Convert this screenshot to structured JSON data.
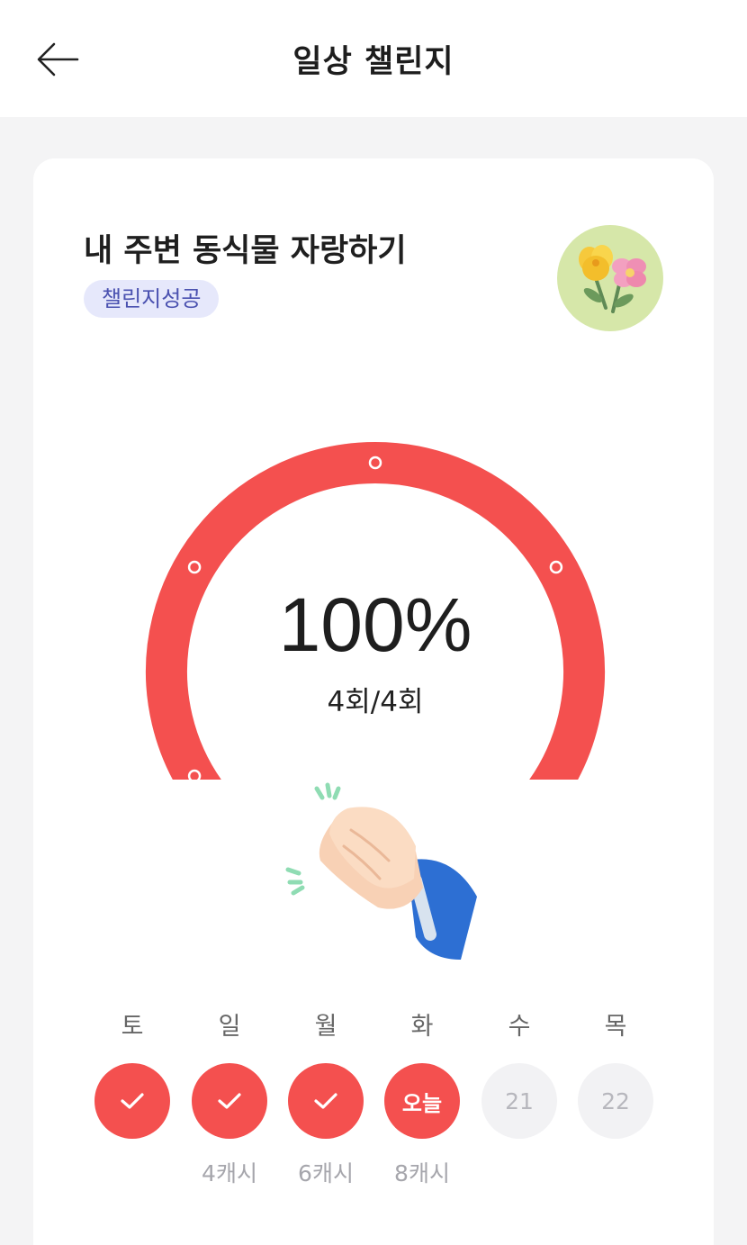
{
  "header": {
    "title": "일상 챌린지",
    "back_icon": "arrow-left-icon"
  },
  "challenge": {
    "title": "내 주변 동식물 자랑하기",
    "status": "챌린지성공",
    "avatar_icon": "flower-bouquet-icon"
  },
  "progress": {
    "percent_text": "100%",
    "count_text": "4회/4회",
    "fraction": 1.0,
    "arc_color": "#f4504f",
    "check_icon": "check-icon"
  },
  "celebration_icon": "clapping-hands-icon",
  "week": {
    "days": [
      {
        "label": "토",
        "state": "done",
        "text": "",
        "reward": ""
      },
      {
        "label": "일",
        "state": "done",
        "text": "",
        "reward": "4캐시"
      },
      {
        "label": "월",
        "state": "done",
        "text": "",
        "reward": "6캐시"
      },
      {
        "label": "화",
        "state": "today",
        "text": "오늘",
        "reward": "8캐시"
      },
      {
        "label": "수",
        "state": "future",
        "text": "21",
        "reward": ""
      },
      {
        "label": "목",
        "state": "future",
        "text": "22",
        "reward": ""
      }
    ]
  },
  "colors": {
    "accent": "#f4504f",
    "badge_bg": "#e6e8fb",
    "badge_text": "#4a51b0",
    "background": "#f4f4f5"
  }
}
